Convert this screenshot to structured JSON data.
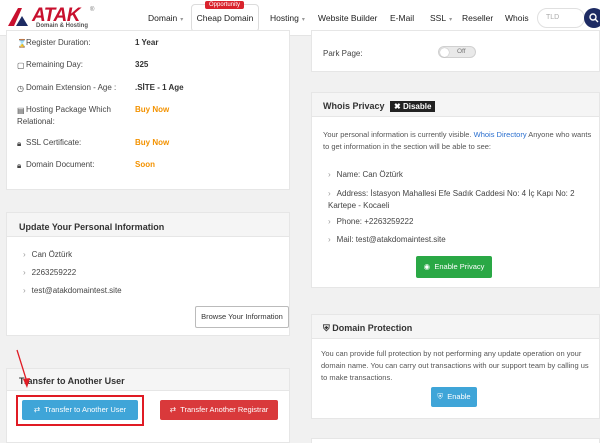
{
  "header": {
    "brand": "ATAK",
    "tagline": "Domain & Hosting",
    "nav": {
      "domain": "Domain",
      "cheap_domain": "Cheap Domain",
      "opportunity_badge": "Opportunity",
      "hosting": "Hosting",
      "website_builder": "Website Builder",
      "email": "E-Mail",
      "ssl": "SSL",
      "reseller": "Reseller",
      "whois": "Whois"
    },
    "search_placeholder": "TLD"
  },
  "domain_info": {
    "rows": [
      {
        "label": "Register Duration:",
        "value": "1 Year"
      },
      {
        "label": "Remaining Day:",
        "value": "325"
      },
      {
        "label": "Domain Extension - Age :",
        "value": ".SİTE - 1 Age"
      },
      {
        "label": "Hosting Package Which Relational:",
        "value": "Buy Now"
      },
      {
        "label": "SSL Certificate:",
        "value": "Buy Now"
      },
      {
        "label": "Domain Document:",
        "value": "Soon"
      }
    ]
  },
  "personal_info": {
    "title": "Update Your Personal Information",
    "name": "Can Öztürk",
    "phone": "2263259222",
    "email": "test@atakdomaintest.site",
    "browse_button": "Browse Your Information"
  },
  "transfer": {
    "title": "Transfer to Another User",
    "transfer_user_button": "Transfer to Another User",
    "transfer_registrar_button": "Transfer Another Registrar"
  },
  "park": {
    "label": "Park Page:",
    "toggle_state": "Off"
  },
  "whois_privacy": {
    "title": "Whois Privacy",
    "status_tag": "Disable",
    "description_pre": "Your personal information is currently visible.",
    "directory_link": "Whois Directory",
    "description_post": "Anyone who wants to get information in the section will be able to see:",
    "name": "Name: Can Öztürk",
    "address": "Address: İstasyon Mahallesi Efe Sadık Caddesi No: 4 İç Kapı No: 2 Kartepe - Kocaeli",
    "phone": "Phone: +2263259222",
    "mail": "Mail: test@atakdomaintest.site",
    "enable_button": "Enable Privacy"
  },
  "domain_protection": {
    "title": "Domain Protection",
    "description": "You can provide full protection by not performing any update operation on your domain name. You can carry out transactions with our support team by calling us to make transactions.",
    "enable_button": "Enable"
  }
}
